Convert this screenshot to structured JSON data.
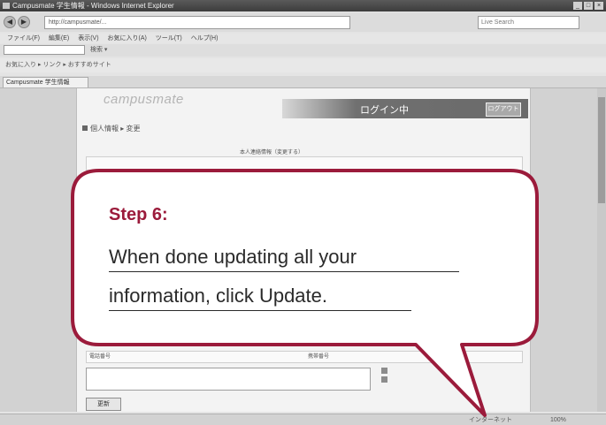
{
  "browser": {
    "window_title": "Campusmate 学生情報 - Windows Internet Explorer",
    "window_buttons": [
      "_",
      "□",
      "×"
    ],
    "url": "http://campusmate/...",
    "search_placeholder": "Live Search",
    "menu": [
      "ファイル(F)",
      "編集(E)",
      "表示(V)",
      "お気に入り(A)",
      "ツール(T)",
      "ヘルプ(H)"
    ],
    "toolbar_text": "検索 ▾",
    "links_text": "お気に入り  ▸ リンク  ▸ おすすめサイト",
    "tab_label": "Campusmate 学生情報"
  },
  "page": {
    "logo": "campusmate",
    "banner_text": "ログイン中",
    "banner_button": "ログアウト",
    "heading": "個人情報 ▸ 変更",
    "form_title": "本人連絡情報（変更する）",
    "bottom_row": {
      "col1": "電話番号",
      "col2": "携帯番号"
    },
    "update_button": "更新"
  },
  "status": {
    "zone": "インターネット",
    "zoom": "100%"
  },
  "callout": {
    "title": "Step 6:",
    "line1": "When done updating all your",
    "line2": "information, click Update.",
    "border_color": "#9b1b3b"
  }
}
